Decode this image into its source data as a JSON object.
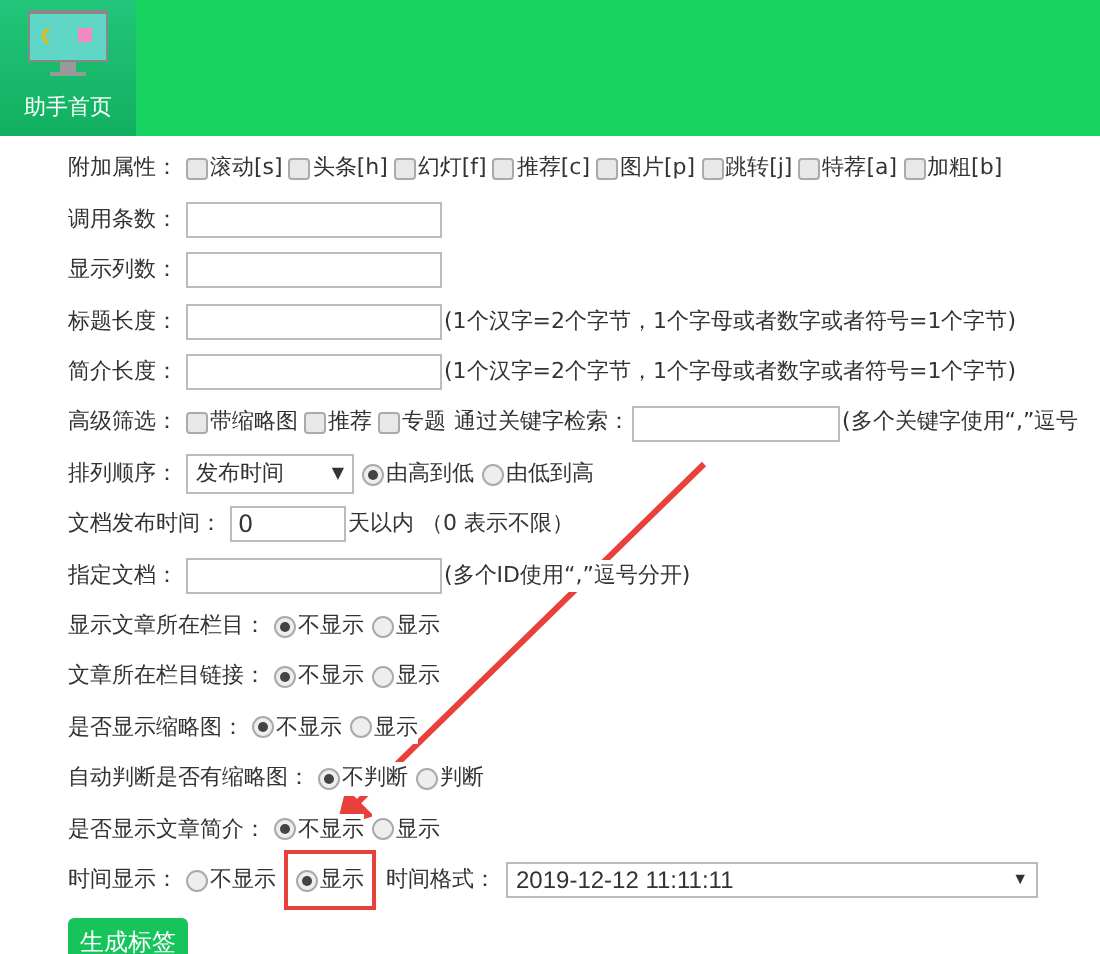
{
  "header": {
    "home_tile": {
      "label": "助手首页"
    }
  },
  "form": [
    {
      "label": "附加属性：",
      "items": [
        {
          "kind": "checkbox",
          "text": "滚动[s]",
          "checked": false
        },
        {
          "kind": "checkbox",
          "text": "头条[h]",
          "checked": false
        },
        {
          "kind": "checkbox",
          "text": "幻灯[f]",
          "checked": false
        },
        {
          "kind": "checkbox",
          "text": "推荐[c]",
          "checked": false
        },
        {
          "kind": "checkbox",
          "text": "图片[p]",
          "checked": false
        },
        {
          "kind": "checkbox",
          "text": "跳转[j]",
          "checked": false
        },
        {
          "kind": "checkbox",
          "text": "特荐[a]",
          "checked": false
        },
        {
          "kind": "checkbox",
          "text": "加粗[b]",
          "checked": false
        }
      ]
    },
    {
      "label": "调用条数：",
      "items": [
        {
          "kind": "input"
        }
      ]
    },
    {
      "label": "显示列数：",
      "items": [
        {
          "kind": "input"
        }
      ]
    },
    {
      "label": "标题长度：",
      "items": [
        {
          "kind": "input"
        },
        {
          "kind": "note",
          "text": "(1个汉字=2个字节，1个字母或者数字或者符号=1个字节)"
        }
      ]
    },
    {
      "label": "简介长度：",
      "items": [
        {
          "kind": "input"
        },
        {
          "kind": "note",
          "text": "(1个汉字=2个字节，1个字母或者数字或者符号=1个字节)"
        }
      ]
    },
    {
      "label": "高级筛选：",
      "items": [
        {
          "kind": "checkbox",
          "text": "带缩略图",
          "checked": false
        },
        {
          "kind": "checkbox",
          "text": "推荐",
          "checked": false
        },
        {
          "kind": "checkbox",
          "text": "专题",
          "checked": false
        },
        {
          "kind": "note",
          "text": "通过关键字检索："
        },
        {
          "kind": "keyword-input"
        },
        {
          "kind": "note",
          "text": "(多个关键字使用“,”逗号"
        }
      ]
    },
    {
      "label": "排列顺序：",
      "items": [
        {
          "kind": "select",
          "value": "发布时间",
          "caret": "▼"
        },
        {
          "kind": "radio",
          "text": "由高到低",
          "selected": true
        },
        {
          "kind": "radio",
          "text": "由低到高",
          "selected": false
        }
      ]
    },
    {
      "label": "文档发布时间：",
      "items": [
        {
          "kind": "small-input",
          "value": "0"
        },
        {
          "kind": "note",
          "text": "天以内 （0 表示不限）"
        }
      ]
    },
    {
      "label": "指定文档：",
      "items": [
        {
          "kind": "input"
        },
        {
          "kind": "note",
          "text": "(多个ID使用“,”逗号分开)"
        }
      ]
    },
    {
      "label": "显示文章所在栏目：",
      "items": [
        {
          "kind": "radio",
          "text": "不显示",
          "selected": true
        },
        {
          "kind": "radio",
          "text": "显示",
          "selected": false
        }
      ]
    },
    {
      "label": "文章所在栏目链接：",
      "items": [
        {
          "kind": "radio",
          "text": "不显示",
          "selected": true
        },
        {
          "kind": "radio",
          "text": "显示",
          "selected": false
        }
      ]
    },
    {
      "label": "是否显示缩略图：",
      "items": [
        {
          "kind": "radio",
          "text": "不显示",
          "selected": true
        },
        {
          "kind": "radio",
          "text": "显示",
          "selected": false
        }
      ]
    },
    {
      "label": "自动判断是否有缩略图：",
      "items": [
        {
          "kind": "radio",
          "text": "不判断",
          "selected": true
        },
        {
          "kind": "radio",
          "text": "判断",
          "selected": false
        }
      ]
    },
    {
      "label": "是否显示文章简介：",
      "items": [
        {
          "kind": "radio",
          "text": "不显示",
          "selected": true
        },
        {
          "kind": "radio",
          "text": "显示",
          "selected": false
        }
      ]
    },
    {
      "label": "时间显示：",
      "items": [
        {
          "kind": "radio",
          "text": "不显示",
          "selected": false
        },
        {
          "kind": "radio",
          "text": "显示",
          "selected": true,
          "highlighted": true
        },
        {
          "kind": "note",
          "text": "时间格式："
        },
        {
          "kind": "wide-select",
          "value": "2019-12-12 11:11:11",
          "caret": "▼"
        }
      ]
    }
  ],
  "submit": {
    "label": "生成标签"
  }
}
